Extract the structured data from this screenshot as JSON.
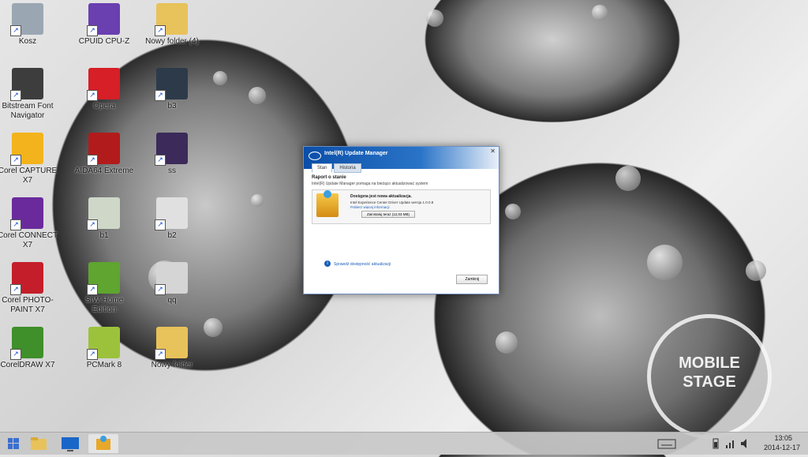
{
  "desktop": {
    "icons": [
      {
        "label": "Kosz",
        "icon": "recycle-bin-icon",
        "color": "#9aa6b2"
      },
      {
        "label": "CPUID CPU-Z",
        "icon": "cpu-z-icon",
        "color": "#6a3fb0"
      },
      {
        "label": "Nowy folder (4)",
        "icon": "folder-icon",
        "color": "#e8c25a"
      },
      {
        "label": "Bitstream Font Navigator",
        "icon": "font-navigator-icon",
        "color": "#3d3d3d"
      },
      {
        "label": "Opera",
        "icon": "opera-icon",
        "color": "#d61f27"
      },
      {
        "label": "b3",
        "icon": "image-file-icon",
        "color": "#2d3a4a"
      },
      {
        "label": "Corel CAPTURE X7",
        "icon": "corel-capture-icon",
        "color": "#f2b31c"
      },
      {
        "label": "AIDA64 Extreme",
        "icon": "aida64-icon",
        "color": "#b21b1b"
      },
      {
        "label": "ss",
        "icon": "image-file-icon",
        "color": "#3b2a5a"
      },
      {
        "label": "Corel CONNECT X7",
        "icon": "corel-connect-icon",
        "color": "#6a2a9c"
      },
      {
        "label": "b1",
        "icon": "image-file-icon",
        "color": "#cfd8c8"
      },
      {
        "label": "b2",
        "icon": "image-file-icon",
        "color": "#e0e0e0"
      },
      {
        "label": "Corel PHOTO-PAINT X7",
        "icon": "corel-photo-paint-icon",
        "color": "#c41e2a"
      },
      {
        "label": "SIW Home Edition",
        "icon": "siw-icon",
        "color": "#5fa52f"
      },
      {
        "label": "qq",
        "icon": "image-file-icon",
        "color": "#d5d5d5"
      },
      {
        "label": "CorelDRAW X7",
        "icon": "coreldraw-icon",
        "color": "#3f8f2a"
      },
      {
        "label": "PCMark 8",
        "icon": "pcmark-icon",
        "color": "#9cc23c"
      },
      {
        "label": "Nowy folder",
        "icon": "folder-icon",
        "color": "#e8c25a"
      }
    ]
  },
  "dialog": {
    "title": "Intel(R) Update Manager",
    "tabs": [
      "Stan",
      "Historia"
    ],
    "heading": "Raport o stanie",
    "subtitle": "Intel(R) Update Manager pomaga na bieżąco aktualizować system",
    "update_title": "Dostępna jest nowa aktualizacja.",
    "update_desc": "Intel Experience Center Driver Update wersja 1.0.0.8",
    "update_link": "Pobierz więcej informacji",
    "download_button": "Zainstaluj teraz (12,03 MB)",
    "info_text": "Sprawdź dostępność aktualizacji",
    "close_button": "Zamknij"
  },
  "watermark": {
    "line1": "MOBILE",
    "line2": "STAGE"
  },
  "taskbar": {
    "items": [
      "start-button",
      "file-explorer-icon",
      "lenovo-app-icon",
      "update-manager-icon"
    ],
    "time": "13:05",
    "date": "2014-12-17"
  }
}
